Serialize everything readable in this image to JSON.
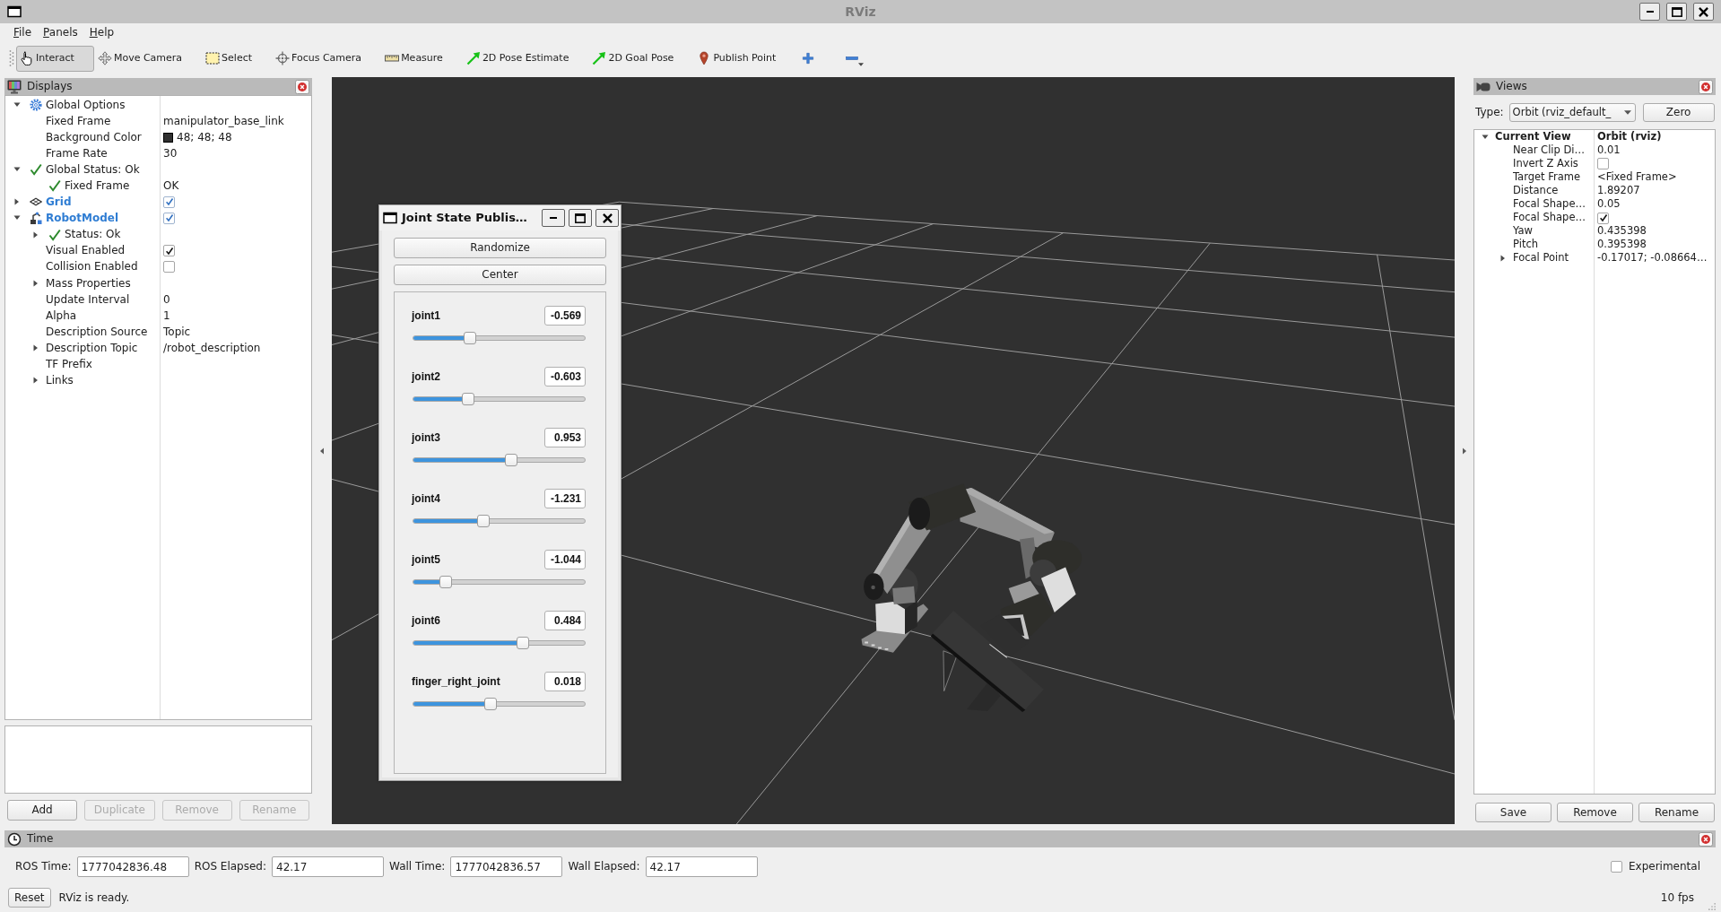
{
  "window": {
    "title": "RViz"
  },
  "menu": [
    "File",
    "Panels",
    "Help"
  ],
  "toolbar": [
    {
      "label": "Interact",
      "selected": true
    },
    {
      "label": "Move Camera",
      "selected": false
    },
    {
      "label": "Select",
      "selected": false
    },
    {
      "label": "Focus Camera",
      "selected": false
    },
    {
      "label": "Measure",
      "selected": false
    },
    {
      "label": "2D Pose Estimate",
      "selected": false
    },
    {
      "label": "2D Goal Pose",
      "selected": false
    },
    {
      "label": "Publish Point",
      "selected": false
    }
  ],
  "displays_panel": {
    "title": "Displays",
    "tree": [
      {
        "kind": "options",
        "label": "Global Options",
        "expanded": true,
        "children": [
          {
            "kind": "property",
            "label": "Fixed Frame",
            "value": "manipulator_base_link"
          },
          {
            "kind": "color",
            "label": "Background Color",
            "value": "48; 48; 48",
            "color": "#303030"
          },
          {
            "kind": "property",
            "label": "Frame Rate",
            "value": "30"
          }
        ]
      },
      {
        "kind": "status",
        "label": "Global Status: Ok",
        "expanded": true,
        "children": [
          {
            "kind": "status",
            "label": "Fixed Frame",
            "value": "OK"
          }
        ]
      },
      {
        "kind": "grid",
        "label": "Grid",
        "expanded": false,
        "checked": true
      },
      {
        "kind": "robot",
        "label": "RobotModel",
        "expanded": true,
        "checked": true,
        "children": [
          {
            "kind": "status",
            "label": "Status: Ok",
            "expanded": false
          },
          {
            "kind": "property",
            "label": "Visual Enabled",
            "checked": true
          },
          {
            "kind": "property",
            "label": "Collision Enabled",
            "checked": false
          },
          {
            "kind": "property",
            "label": "Mass Properties",
            "expanded": false
          },
          {
            "kind": "property",
            "label": "Update Interval",
            "value": "0"
          },
          {
            "kind": "property",
            "label": "Alpha",
            "value": "1"
          },
          {
            "kind": "property",
            "label": "Description Source",
            "value": "Topic"
          },
          {
            "kind": "property",
            "label": "Description Topic",
            "value": "/robot_description",
            "expanded": false
          },
          {
            "kind": "property",
            "label": "TF Prefix"
          },
          {
            "kind": "property",
            "label": "Links",
            "expanded": false
          }
        ]
      }
    ],
    "buttons": [
      {
        "label": "Add",
        "disabled": false
      },
      {
        "label": "Duplicate",
        "disabled": true
      },
      {
        "label": "Remove",
        "disabled": true
      },
      {
        "label": "Rename",
        "disabled": true
      }
    ]
  },
  "joint_state_publisher": {
    "title": "Joint State Publis…",
    "buttons": [
      "Randomize",
      "Center"
    ],
    "joints": [
      {
        "name": "joint1",
        "value": "-0.569",
        "level": 0.33
      },
      {
        "name": "joint2",
        "value": "-0.603",
        "level": 0.32
      },
      {
        "name": "joint3",
        "value": "0.953",
        "level": 0.57
      },
      {
        "name": "joint4",
        "value": "-1.231",
        "level": 0.41
      },
      {
        "name": "joint5",
        "value": "-1.044",
        "level": 0.19
      },
      {
        "name": "joint6",
        "value": "0.484",
        "level": 0.64
      },
      {
        "name": "finger_right_joint",
        "value": "0.018",
        "level": 0.45
      }
    ]
  },
  "views_panel": {
    "title": "Views",
    "type_label": "Type:",
    "type_value": "Orbit (rviz_default_",
    "zero_button": "Zero",
    "tree": [
      {
        "kind": "group",
        "label": "Current View",
        "value": "Orbit (rviz)",
        "expanded": true,
        "children": [
          {
            "kind": "property",
            "label": "Near Clip Di…",
            "value": "0.01"
          },
          {
            "kind": "property",
            "label": "Invert Z Axis",
            "checked": false
          },
          {
            "kind": "property",
            "label": "Target Frame",
            "value": "<Fixed Frame>"
          },
          {
            "kind": "property",
            "label": "Distance",
            "value": "1.89207"
          },
          {
            "kind": "property",
            "label": "Focal Shape…",
            "value": "0.05"
          },
          {
            "kind": "property",
            "label": "Focal Shape…",
            "checked": true
          },
          {
            "kind": "property",
            "label": "Yaw",
            "value": "0.435398"
          },
          {
            "kind": "property",
            "label": "Pitch",
            "value": "0.395398"
          },
          {
            "kind": "property",
            "label": "Focal Point",
            "value": "-0.17017; -0.08664…",
            "expanded": false
          }
        ]
      }
    ],
    "buttons": [
      "Save",
      "Remove",
      "Rename"
    ]
  },
  "time_panel": {
    "title": "Time",
    "fields": [
      {
        "label": "ROS Time:",
        "value": "1777042836.48"
      },
      {
        "label": "ROS Elapsed:",
        "value": "42.17"
      },
      {
        "label": "Wall Time:",
        "value": "1777042836.57"
      },
      {
        "label": "Wall Elapsed:",
        "value": "42.17"
      }
    ],
    "experimental": {
      "label": "Experimental",
      "checked": false
    },
    "reset_button": "Reset",
    "status": "RViz is ready.",
    "fps": "10 fps"
  }
}
